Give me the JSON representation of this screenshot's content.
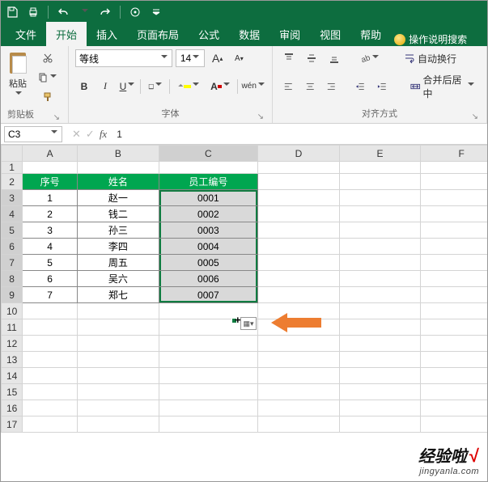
{
  "qat": {
    "save": "save-icon",
    "print": "print-icon",
    "undo": "undo-icon",
    "redo": "redo-icon"
  },
  "tabs": [
    "文件",
    "开始",
    "插入",
    "页面布局",
    "公式",
    "数据",
    "审阅",
    "视图",
    "帮助"
  ],
  "active_tab": 1,
  "tell_me": "操作说明搜索",
  "ribbon": {
    "clipboard": {
      "paste": "粘贴",
      "label": "剪贴板"
    },
    "font": {
      "name": "等线",
      "size": "14",
      "grow": "A",
      "shrink": "A",
      "bold": "B",
      "italic": "I",
      "underline": "U",
      "ruby": "wén",
      "label": "字体"
    },
    "alignment": {
      "wrap": "自动换行",
      "merge": "合并后居中",
      "label": "对齐方式"
    }
  },
  "namebox": "C3",
  "formula": "1",
  "columns": [
    "A",
    "B",
    "C",
    "D",
    "E",
    "F"
  ],
  "table": {
    "headers": [
      "序号",
      "姓名",
      "员工编号"
    ],
    "rows": [
      [
        "1",
        "赵一",
        "0001"
      ],
      [
        "2",
        "钱二",
        "0002"
      ],
      [
        "3",
        "孙三",
        "0003"
      ],
      [
        "4",
        "李四",
        "0004"
      ],
      [
        "5",
        "周五",
        "0005"
      ],
      [
        "6",
        "吴六",
        "0006"
      ],
      [
        "7",
        "郑七",
        "0007"
      ]
    ]
  },
  "selection": "C3:C9",
  "watermark": {
    "line1": "经验啦",
    "check": "√",
    "line2": "jingyanla.com"
  }
}
